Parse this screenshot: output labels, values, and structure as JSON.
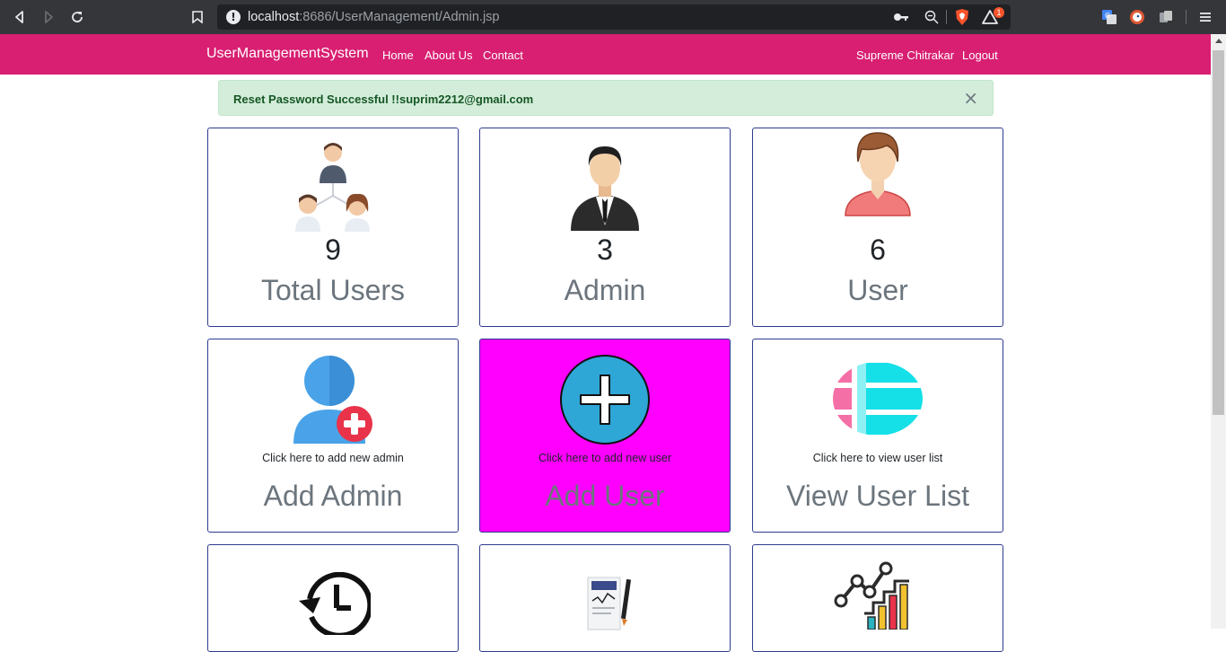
{
  "browser": {
    "url_host": "localhost",
    "url_rest": ":8686/UserManagement/Admin.jsp",
    "brave_badge": "1"
  },
  "navbar": {
    "brand": "UserManagementSystem",
    "links": [
      "Home",
      "About Us",
      "Contact"
    ],
    "user_name": "Supreme Chitrakar",
    "logout": "Logout"
  },
  "alert": {
    "message": "Reset Password Successful !!suprim2212@gmail.com",
    "close": "×"
  },
  "stats": [
    {
      "count": "9",
      "title": "Total Users",
      "icon": "group-users-icon"
    },
    {
      "count": "3",
      "title": "Admin",
      "icon": "admin-icon"
    },
    {
      "count": "6",
      "title": "User",
      "icon": "user-icon"
    }
  ],
  "actions": [
    {
      "caption": "Click here to add new admin",
      "title": "Add Admin",
      "icon": "add-admin-icon"
    },
    {
      "caption": "Click here to add new user",
      "title": "Add User",
      "icon": "add-circle-icon"
    },
    {
      "caption": "Click here to view user list",
      "title": "View User List",
      "icon": "list-icon"
    }
  ],
  "more_cards": [
    {
      "icon": "history-icon"
    },
    {
      "icon": "report-icon"
    },
    {
      "icon": "analytics-icon"
    }
  ],
  "colors": {
    "navbar": "#d81f72",
    "add_user_card": "#ff00ff",
    "alert_bg": "#d4edda",
    "alert_text": "#155724",
    "card_border": "#2f3b8f"
  }
}
